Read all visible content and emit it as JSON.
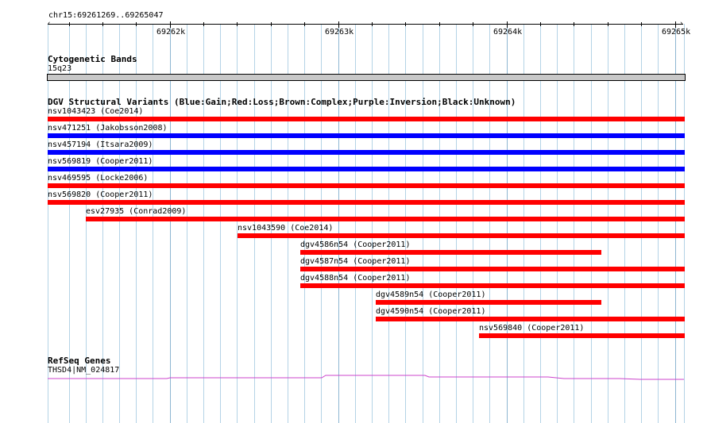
{
  "ruler": {
    "location": "chr15:69261269..69265047",
    "ticks": [
      "69262k",
      "69263k",
      "69264k",
      "69265k"
    ]
  },
  "cyto": {
    "title": "Cytogenetic Bands",
    "band": "15q23",
    "band_color": "#c8c8c8"
  },
  "dgv": {
    "title": "DGV Structural Variants (Blue:Gain;Red:Loss;Brown:Complex;Purple:Inversion;Black:Unknown)",
    "colors": {
      "loss": "#ff0000",
      "gain": "#0000ff"
    },
    "features": [
      {
        "label": "nsv1043423 (Coe2014)",
        "type": "loss"
      },
      {
        "label": "nsv471251 (Jakobsson2008)",
        "type": "gain"
      },
      {
        "label": "nsv457194 (Itsara2009)",
        "type": "gain"
      },
      {
        "label": "nsv569819 (Cooper2011)",
        "type": "gain"
      },
      {
        "label": "nsv469595 (Locke2006)",
        "type": "loss"
      },
      {
        "label": "nsv569820 (Cooper2011)",
        "type": "loss"
      },
      {
        "label": "esv27935 (Conrad2009)",
        "type": "loss"
      },
      {
        "label": "nsv1043590 (Coe2014)",
        "type": "loss"
      },
      {
        "label": "dgv4586n54 (Cooper2011)",
        "type": "loss"
      },
      {
        "label": "dgv4587n54 (Cooper2011)",
        "type": "loss"
      },
      {
        "label": "dgv4588n54 (Cooper2011)",
        "type": "loss"
      },
      {
        "label": "dgv4589n54 (Cooper2011)",
        "type": "loss"
      },
      {
        "label": "dgv4590n54 (Cooper2011)",
        "type": "loss"
      },
      {
        "label": "nsv569840 (Cooper2011)",
        "type": "loss"
      }
    ]
  },
  "refseq": {
    "title": "RefSeq Genes",
    "gene_label": "THSD4|NM_024817",
    "gene_color": "#cc44cc"
  }
}
